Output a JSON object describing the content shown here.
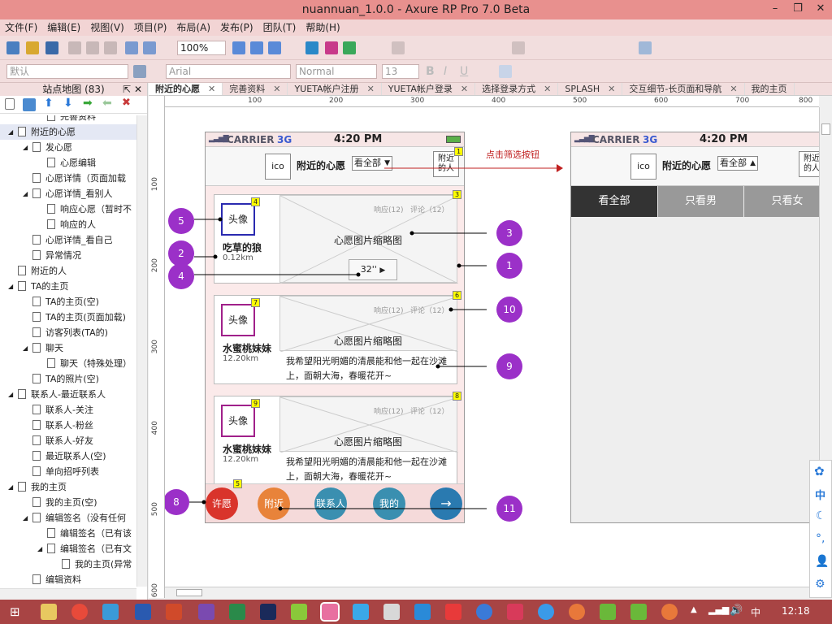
{
  "window": {
    "title": "nuannuan_1.0.0 - Axure RP Pro 7.0 Beta"
  },
  "menu": [
    "文件(F)",
    "编辑(E)",
    "视图(V)",
    "项目(P)",
    "布局(A)",
    "发布(P)",
    "团队(T)",
    "帮助(H)"
  ],
  "toolbar": {
    "zoom": "100%",
    "style_select": "默认",
    "font": "Arial",
    "font_style": "Normal",
    "font_size": "13"
  },
  "sitemap": {
    "title": "站点地图 (83)",
    "items": [
      "完善资料",
      "附近的心愿",
      "发心愿",
      "心愿编辑",
      "心愿详情（页面加载",
      "心愿详情_看别人",
      "响应心愿（暂时不",
      "响应的人",
      "心愿详情_看自己",
      "异常情况",
      "附近的人",
      "TA的主页",
      "TA的主页(空)",
      "TA的主页(页面加载)",
      "访客列表(TA的)",
      "聊天",
      "聊天（特殊处理）",
      "TA的照片(空)",
      "联系人-最近联系人",
      "联系人-关注",
      "联系人-粉丝",
      "联系人-好友",
      "最近联系人(空)",
      "单向招呼列表",
      "我的主页",
      "我的主页(空)",
      "编辑签名（没有任何",
      "编辑签名（已有该",
      "编辑签名（已有文",
      "我的主页(异常",
      "编辑资料"
    ]
  },
  "tabs": [
    "附近的心愿",
    "完善资料",
    "YUETA帐户注册",
    "YUETA帐户登录",
    "选择登录方式",
    "SPLASH",
    "交互细节-长页面和导航",
    "我的主页"
  ],
  "ruler_h": [
    "100",
    "200",
    "300",
    "400",
    "500",
    "600",
    "700",
    "800"
  ],
  "ruler_v": [
    "100",
    "200",
    "300",
    "400",
    "500",
    "600"
  ],
  "phone1": {
    "carrier": "CARRIER",
    "network": "3G",
    "time": "4:20 PM",
    "ico": "ico",
    "title": "附近的心愿",
    "filter": "看全部",
    "nearby": "附近\n的人",
    "cards": [
      {
        "avatar": "头像",
        "name": "吃草的狼",
        "distance": "0.12km",
        "stats": "响应(12)   评论（12）",
        "image": "心愿图片缩略图",
        "audio": "32''"
      },
      {
        "avatar": "头像",
        "name": "水蜜桃妹妹",
        "distance": "12.20km",
        "stats": "响应(12)   评论（12）",
        "image": "心愿图片缩略图",
        "text": "我希望阳光明媚的清晨能和他一起在沙滩上，面朝大海，春暖花开~"
      },
      {
        "avatar": "头像",
        "name": "水蜜桃妹妹",
        "distance": "12.20km",
        "stats": "响应(12)   评论（12）",
        "image": "心愿图片缩略图",
        "text": "我希望阳光明媚的清晨能和他一起在沙滩上，面朝大海，春暖花开~"
      }
    ],
    "bottom_tabs": [
      "许愿",
      "附近",
      "联系人",
      "我的",
      "→"
    ]
  },
  "annotation": {
    "label": "点击筛选按钮"
  },
  "callouts": [
    "5",
    "2",
    "4",
    "3",
    "1",
    "10",
    "9",
    "8",
    "11"
  ],
  "badges": [
    "1",
    "3",
    "4",
    "7",
    "6",
    "9",
    "8",
    "5"
  ],
  "phone2": {
    "carrier": "CARRIER",
    "network": "3G",
    "time": "4:20 PM",
    "ico": "ico",
    "title": "附近的心愿",
    "filter": "看全部",
    "nearby": "附近\n的人",
    "segments": [
      "看全部",
      "只看男",
      "只看女"
    ]
  },
  "taskbar": {
    "time": "12:18",
    "ime": "中"
  },
  "colors": {
    "titlebar": "#e8908e",
    "callout": "#9b30c8",
    "tab_wish": "#d9342b",
    "tab_nearby": "#e8833a",
    "tab_blue": "#3a8fb0"
  }
}
